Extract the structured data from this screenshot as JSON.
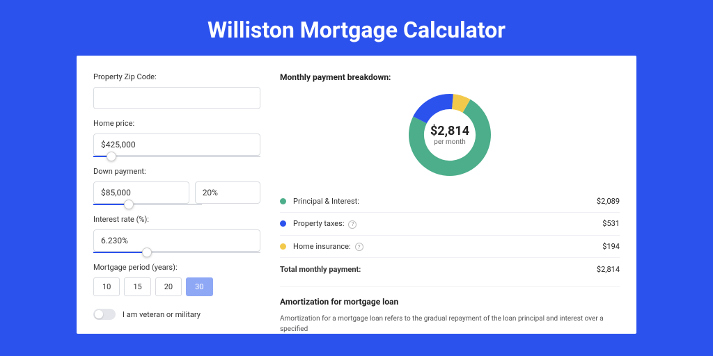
{
  "header": {
    "title": "Williston Mortgage Calculator"
  },
  "form": {
    "zip_label": "Property Zip Code:",
    "zip_value": "",
    "price_label": "Home price:",
    "price_value": "$425,000",
    "down_label": "Down payment:",
    "down_value": "$85,000",
    "down_pct": "20%",
    "rate_label": "Interest rate (%):",
    "rate_value": "6.230%",
    "period_label": "Mortgage period (years):",
    "periods": [
      "10",
      "15",
      "20",
      "30"
    ],
    "period_selected": "30",
    "veteran_label": "I am veteran or military"
  },
  "breakdown": {
    "title": "Monthly payment breakdown:",
    "center_value": "$2,814",
    "center_sub": "per month",
    "items": [
      {
        "label": "Principal & Interest:",
        "value": "$2,089",
        "color": "#4cae8a",
        "info": false
      },
      {
        "label": "Property taxes:",
        "value": "$531",
        "color": "#2c52ed",
        "info": true
      },
      {
        "label": "Home insurance:",
        "value": "$194",
        "color": "#f3c94b",
        "info": true
      }
    ],
    "total_label": "Total monthly payment:",
    "total_value": "$2,814"
  },
  "amort": {
    "title": "Amortization for mortgage loan",
    "text": "Amortization for a mortgage loan refers to the gradual repayment of the loan principal and interest over a specified"
  },
  "chart_data": {
    "type": "pie",
    "title": "Monthly payment breakdown",
    "series": [
      {
        "name": "Principal & Interest",
        "value": 2089,
        "color": "#4cae8a"
      },
      {
        "name": "Property taxes",
        "value": 531,
        "color": "#2c52ed"
      },
      {
        "name": "Home insurance",
        "value": 194,
        "color": "#f3c94b"
      }
    ],
    "total": 2814
  }
}
